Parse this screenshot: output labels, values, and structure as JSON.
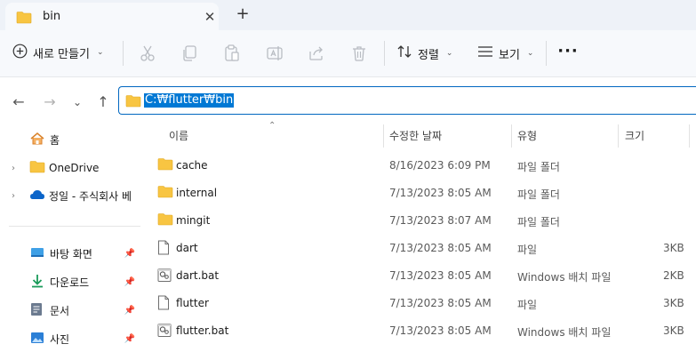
{
  "window": {
    "tab_title": "bin",
    "close_glyph": "✕",
    "new_tab_glyph": "+"
  },
  "toolbar": {
    "new_label": "새로 만들기",
    "sort_label": "정렬",
    "view_label": "보기",
    "more_glyph": "···"
  },
  "address": {
    "path": "C:₩flutter₩bin"
  },
  "nav_pane": {
    "items": [
      {
        "label": "홈",
        "icon": "home-icon"
      },
      {
        "label": "OneDrive",
        "icon": "folder-icon"
      },
      {
        "label": "정일 - 주식회사 베",
        "icon": "cloud-icon"
      }
    ],
    "quick_access": [
      {
        "label": "바탕 화면",
        "icon": "desktop-icon"
      },
      {
        "label": "다운로드",
        "icon": "download-icon"
      },
      {
        "label": "문서",
        "icon": "document-icon"
      },
      {
        "label": "사진",
        "icon": "picture-icon"
      }
    ]
  },
  "columns": {
    "name": "이름",
    "date": "수정한 날짜",
    "type": "유형",
    "size": "크기"
  },
  "files": [
    {
      "name": "cache",
      "date": "8/16/2023 6:09 PM",
      "type": "파일 폴더",
      "size": "",
      "icon": "folder-icon"
    },
    {
      "name": "internal",
      "date": "7/13/2023 8:05 AM",
      "type": "파일 폴더",
      "size": "",
      "icon": "folder-icon"
    },
    {
      "name": "mingit",
      "date": "7/13/2023 8:07 AM",
      "type": "파일 폴더",
      "size": "",
      "icon": "folder-icon"
    },
    {
      "name": "dart",
      "date": "7/13/2023 8:05 AM",
      "type": "파일",
      "size": "3KB",
      "icon": "file-icon"
    },
    {
      "name": "dart.bat",
      "date": "7/13/2023 8:05 AM",
      "type": "Windows 배치 파일",
      "size": "2KB",
      "icon": "batch-file-icon"
    },
    {
      "name": "flutter",
      "date": "7/13/2023 8:05 AM",
      "type": "파일",
      "size": "3KB",
      "icon": "file-icon"
    },
    {
      "name": "flutter.bat",
      "date": "7/13/2023 8:05 AM",
      "type": "Windows 배치 파일",
      "size": "3KB",
      "icon": "batch-file-icon"
    }
  ],
  "colors": {
    "accent": "#0078d4",
    "folder": "#f8c542",
    "tabbar": "#eef2f8"
  }
}
